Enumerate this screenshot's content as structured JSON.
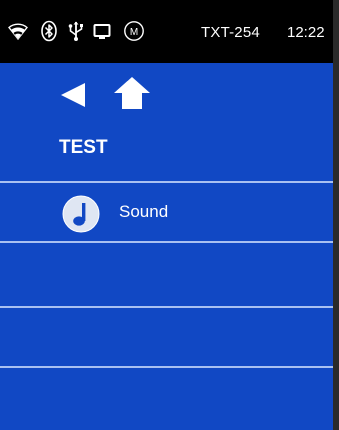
{
  "status_bar": {
    "icons": [
      "wifi-icon",
      "bluetooth-icon",
      "usb-icon",
      "screen-icon",
      "m-circle-icon"
    ],
    "m_icon_letter": "M",
    "model": "TXT-254",
    "time": "12:22"
  },
  "navigation": {
    "back_icon": "back-arrow-icon",
    "home_icon": "home-icon"
  },
  "page": {
    "title": "TEST"
  },
  "list": {
    "items": [
      {
        "label": "Sound",
        "icon": "music-note-icon"
      }
    ]
  },
  "colors": {
    "background": "#1148c4",
    "divider": "#a9c1f2",
    "status_bar": "#000000",
    "text": "#ffffff"
  }
}
